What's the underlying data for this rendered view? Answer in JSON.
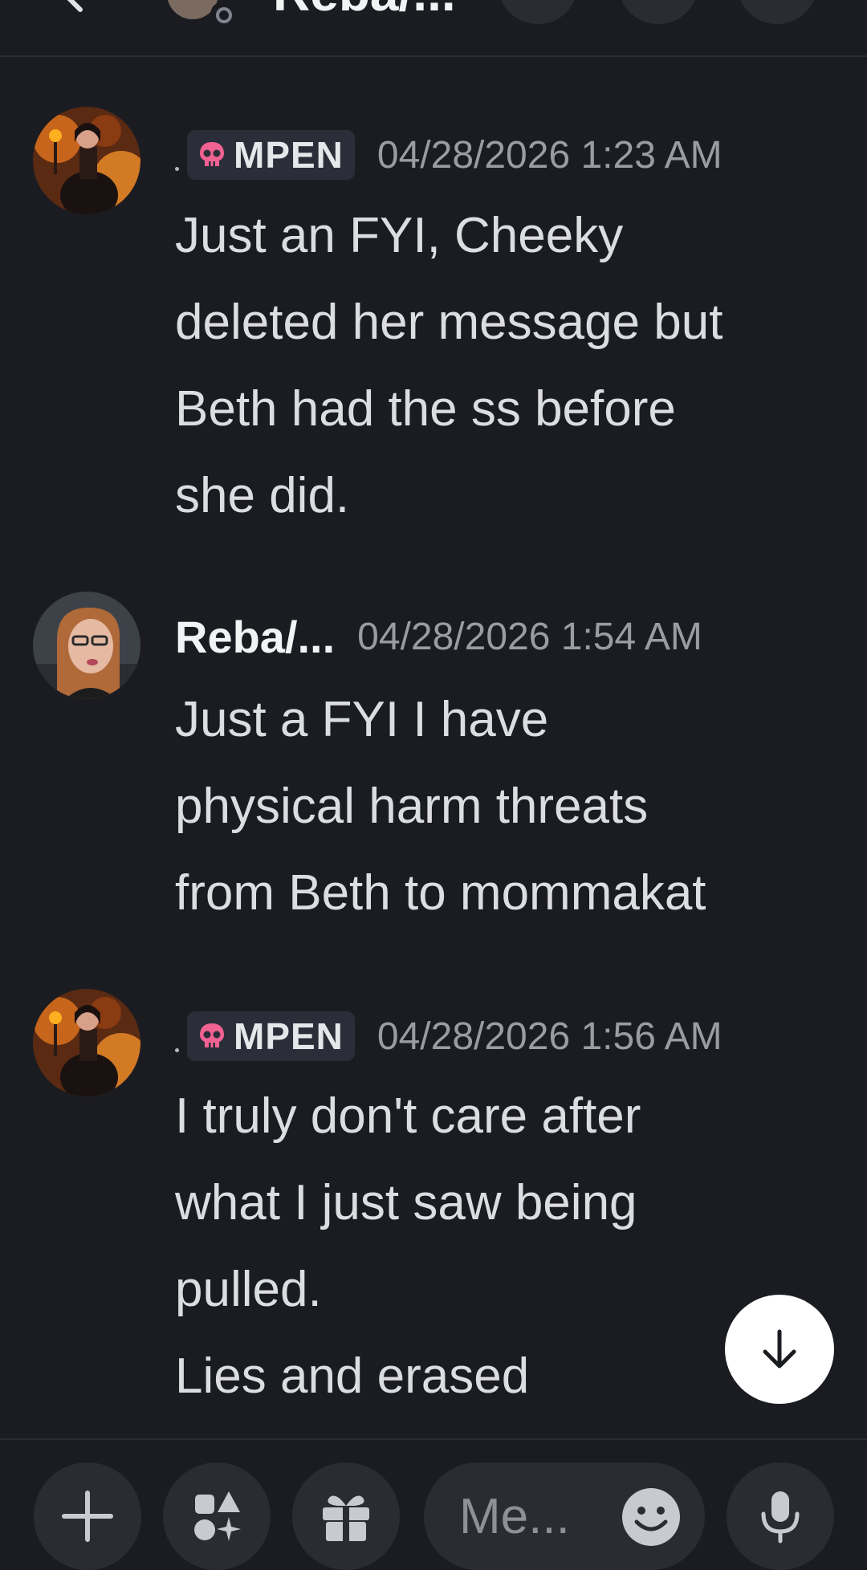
{
  "header": {
    "title": "Reba/..."
  },
  "messages": [
    {
      "author_tag": "MPEN",
      "timestamp": "04/28/2026 1:23 AM",
      "lines": [
        "Just an FYI, Cheeky",
        "deleted her message but",
        "Beth had the ss before",
        "she did."
      ]
    },
    {
      "author": "Reba/...",
      "timestamp": "04/28/2026 1:54 AM",
      "lines": [
        "Just a FYI I have",
        "physical harm threats",
        "from Beth to mommakat"
      ]
    },
    {
      "author_tag": "MPEN",
      "timestamp": "04/28/2026 1:56 AM",
      "lines": [
        "I truly don't care after",
        "what I just saw  being",
        "pulled.",
        "Lies and erased"
      ]
    }
  ],
  "composer": {
    "placeholder": "Me..."
  },
  "icons": {
    "plus": "plus-icon",
    "apps": "apps-icon",
    "gift": "gift-icon",
    "mic": "microphone-icon",
    "emoji": "emoji-icon",
    "scroll": "arrow-down-icon",
    "tag": "skull-icon"
  },
  "colors": {
    "background": "#1b1c21",
    "tag_background": "#2b2d38",
    "skull": "#f06292",
    "timestamp": "#9b9ca3"
  }
}
